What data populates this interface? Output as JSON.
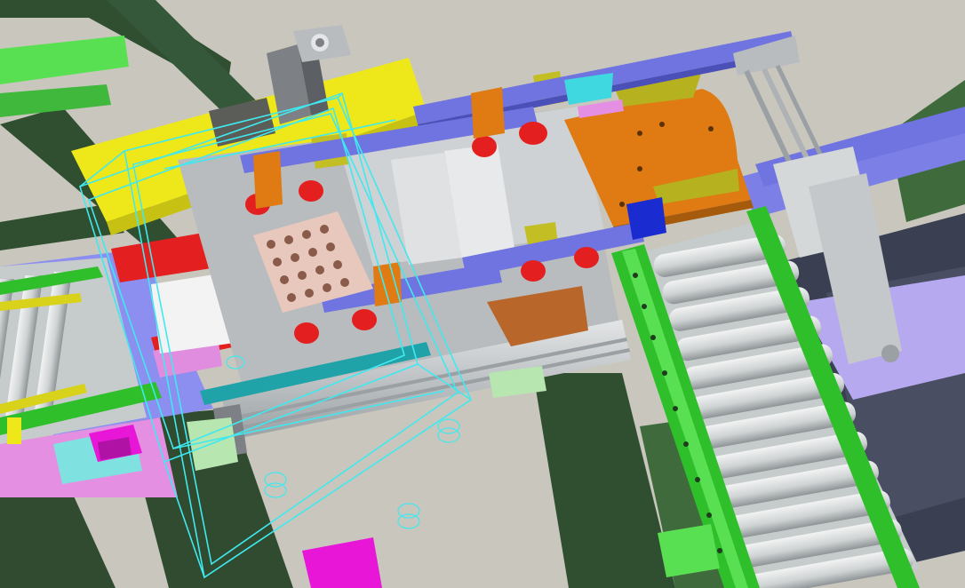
{
  "viewport": {
    "type": "3d-cad-assembly",
    "background": "#c9c7bd",
    "colors": {
      "frame_dark": "#2f4f30",
      "frame_mid": "#3e6a3c",
      "rail_green": "#2fbf2a",
      "rail_green_light": "#59e052",
      "roller": "#d9dcdc",
      "roller_shade": "#9ea4a6",
      "plate_yellow": "#eee71a",
      "plate_orange": "#e07a12",
      "plate_red": "#e41f1f",
      "bar_blue": "#6f74e0",
      "bar_blue_dark": "#4b4fb8",
      "lilac": "#b6a9f0",
      "gray_metal": "#b8bcbf",
      "gray_dark": "#6e7276",
      "cyan_wire": "#3fe9ef",
      "teal_rail": "#20a3a8",
      "magenta": "#e817d8",
      "pink": "#e58fe2",
      "copper": "#b8662a",
      "olive": "#b5b11f",
      "navy": "#1a2bd0",
      "pale_green": "#b7e6b0"
    },
    "components": [
      "left-roller-conveyor",
      "right-roller-conveyor",
      "gantry-frame",
      "yellow-base-plate",
      "orange-mount-plate",
      "linear-actuator",
      "pneumatic-cylinder",
      "vacuum-gripper-pad",
      "wireframe-bin"
    ]
  }
}
